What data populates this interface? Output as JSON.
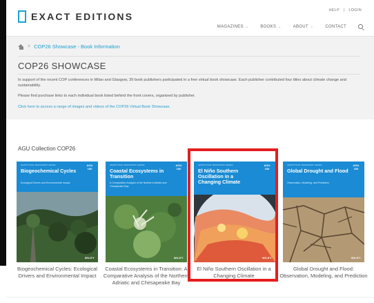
{
  "header": {
    "logo_text": "EXACT EDITIONS",
    "help": "HELP",
    "util_sep": "|",
    "login": "LOGIN",
    "nav": [
      {
        "label": "MAGAZINES",
        "caret": "⌄"
      },
      {
        "label": "BOOKS",
        "caret": "⌄"
      },
      {
        "label": "ABOUT",
        "caret": "⌄"
      },
      {
        "label": "CONTACT",
        "caret": ""
      }
    ]
  },
  "breadcrumb": {
    "sep": ">",
    "current": "COP26 Showcase - Book Information"
  },
  "page": {
    "title": "COP26 SHOWCASE",
    "intro": "In support of the recent COP conferences in Milan and Glasgow, 39 book publishers participated in a free virtual book showcase. Each publisher contributed four titles about climate change and sustainability.",
    "purchase": "Please find purchase links to each individual book listed behind the front covers, organised by publisher.",
    "more_link": "Click here to access a range of images and videos of the COP26 Virtual Book Showcase."
  },
  "collection": {
    "title": "AGU Collection COP26",
    "books": [
      {
        "cover_title": "Biogeochemical Cycles",
        "cover_subtitle": "Ecological Drivers and Environmental Impact",
        "caption": "Biogeochemical Cycles: Ecological Drivers and Environmental Impact"
      },
      {
        "cover_title": "Coastal Ecosystems in Transition",
        "cover_subtitle": "A Comparative Analysis of the Northern Adriatic and Chesapeake Bay",
        "caption": "Coastal Ecosystems in Transition: A Comparative Analysis of the Northern Adriatic and Chesapeake Bay"
      },
      {
        "cover_title": "El Niño Southern Oscillation in a Changing Climate",
        "cover_subtitle": "",
        "caption": "El Niño Southern Oscillation in a Changing Climate"
      },
      {
        "cover_title": "Global Drought and Flood",
        "cover_subtitle": "Observation, Modeling, and Prediction",
        "caption": "Global Drought and Flood: Observation, Modeling, and Prediction"
      }
    ],
    "cover_common": {
      "series": "GEOPHYSICAL MONOGRAPH SERIES",
      "badge": "AGU 100",
      "publisher": "WILEY"
    }
  },
  "colors": {
    "accent": "#1e9dd0",
    "cover_blue": "#1a8bd4",
    "highlight": "#e41e1e"
  }
}
